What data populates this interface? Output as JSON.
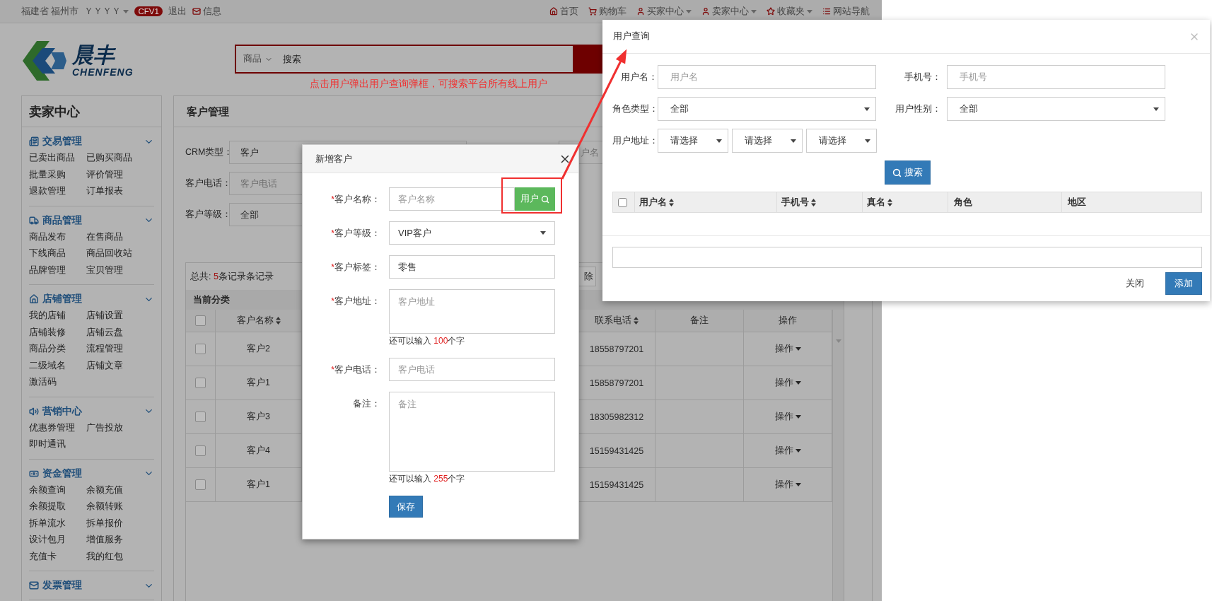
{
  "top_bar": {
    "location": "福建省 福州市",
    "user": "ＹＹＹＹ",
    "badge": "CFV1",
    "logout": "退出",
    "messages": "信息",
    "right": [
      {
        "label": "首页",
        "dropdown": false
      },
      {
        "label": "购物车",
        "dropdown": false
      },
      {
        "label": "买家中心",
        "dropdown": true
      },
      {
        "label": "卖家中心",
        "dropdown": true
      },
      {
        "label": "收藏夹",
        "dropdown": true
      },
      {
        "label": "网站导航",
        "dropdown": false
      }
    ]
  },
  "header": {
    "logo_name": "晨丰",
    "logo_sub": "CHENFENG",
    "search_category": "商品",
    "search_value": "搜索",
    "annotation": "点击用户弹出用户查询弹框，可搜索平台所有线上用户"
  },
  "sidebar": {
    "title": "卖家中心",
    "sections": [
      {
        "title": "交易管理",
        "expanded": true,
        "items": [
          "已卖出商品",
          "已购买商品",
          "批量采购",
          "评价管理",
          "退款管理",
          "订单报表"
        ]
      },
      {
        "title": "商品管理",
        "expanded": true,
        "items": [
          "商品发布",
          "在售商品",
          "下线商品",
          "商品回收站",
          "品牌管理",
          "宝贝管理"
        ]
      },
      {
        "title": "店铺管理",
        "expanded": true,
        "items": [
          "我的店铺",
          "店铺设置",
          "店铺装修",
          "店铺云盘",
          "商品分类",
          "流程管理",
          "二级域名",
          "店铺文章",
          "激活码"
        ]
      },
      {
        "title": "营销中心",
        "expanded": true,
        "items": [
          "优惠券管理",
          "广告投放",
          "即时通讯"
        ]
      },
      {
        "title": "资金管理",
        "expanded": true,
        "items": [
          "余额查询",
          "余额充值",
          "余额提取",
          "余额转账",
          "拆单流水",
          "拆单报价",
          "设计包月",
          "增值服务",
          "充值卡",
          "我的红包"
        ]
      },
      {
        "title": "发票管理",
        "expanded": true
      }
    ]
  },
  "main": {
    "title": "客户管理",
    "filters": [
      {
        "kind": "select",
        "label": "CRM类型：",
        "value": "客户"
      },
      {
        "kind": "input",
        "label": "客户电话：",
        "placeholder": "客户电话"
      },
      {
        "kind": "select",
        "label": "客户等级：",
        "value": "全部"
      }
    ],
    "partial_field": "户名",
    "partial_button": "除",
    "summary": {
      "prefix": "总共: ",
      "count": "5",
      "suffix": "条记录条记录"
    },
    "category_label": "当前分类",
    "select_all_checked": false,
    "columns": [
      {
        "label": "客户名称",
        "sortable": true
      },
      {
        "label": "联系电话",
        "sortable": true
      },
      {
        "label": "备注",
        "sortable": false
      },
      {
        "label": "操作",
        "sortable": false
      }
    ],
    "rows": [
      {
        "checked": false,
        "name": "客户2",
        "phone": "18558797201",
        "action": "操作"
      },
      {
        "checked": false,
        "name": "客户1",
        "phone": "15858797201",
        "action": "操作"
      },
      {
        "checked": false,
        "name": "客户3",
        "phone": "18305982312",
        "action": "操作"
      },
      {
        "checked": false,
        "name": "客户4",
        "phone": "15159431425",
        "action": "操作"
      },
      {
        "checked": false,
        "name": "客户1",
        "phone": "15159431425",
        "action": "操作"
      }
    ]
  },
  "add_customer_dialog": {
    "title": "新增客户",
    "required_mark": "*",
    "fields": [
      {
        "kind": "input_with_button",
        "required": true,
        "label": "客户名称：",
        "placeholder": "客户名称",
        "button": "用户"
      },
      {
        "kind": "select",
        "required": true,
        "label": "客户等级：",
        "value": "VIP客户"
      },
      {
        "kind": "input",
        "required": true,
        "label": "客户标签：",
        "value": "零售"
      },
      {
        "kind": "textarea",
        "required": true,
        "label": "客户地址：",
        "placeholder": "客户地址",
        "hint": {
          "prefix": "还可以输入 ",
          "count": "100",
          "suffix": "个字"
        }
      },
      {
        "kind": "input",
        "required": true,
        "label": "客户电话：",
        "placeholder": "客户电话"
      },
      {
        "kind": "textarea_large",
        "required": false,
        "label": "备注：",
        "placeholder": "备注",
        "hint": {
          "prefix": "还可以输入 ",
          "count": "255",
          "suffix": "个字"
        }
      }
    ],
    "save_button": "保存"
  },
  "user_query_dialog": {
    "title": "用户查询",
    "fields": [
      {
        "kind": "input",
        "label": "用户名：",
        "placeholder": "用户名"
      },
      {
        "kind": "input",
        "label": "手机号：",
        "placeholder": "手机号"
      },
      {
        "kind": "select",
        "label": "角色类型：",
        "value": "全部"
      },
      {
        "kind": "select",
        "label": "用户性别：",
        "value": "全部"
      }
    ],
    "address": {
      "label": "用户地址：",
      "selects": [
        "请选择",
        "请选择",
        "请选择"
      ]
    },
    "search_button": "搜索",
    "columns": [
      {
        "label": "用户名",
        "sortable": true
      },
      {
        "label": "手机号",
        "sortable": true
      },
      {
        "label": "真名",
        "sortable": true
      },
      {
        "label": "角色",
        "sortable": false
      },
      {
        "label": "地区",
        "sortable": false
      }
    ],
    "select_all_checked": false,
    "footer_buttons": [
      {
        "label": "关闭",
        "primary": false
      },
      {
        "label": "添加",
        "primary": true
      }
    ]
  }
}
